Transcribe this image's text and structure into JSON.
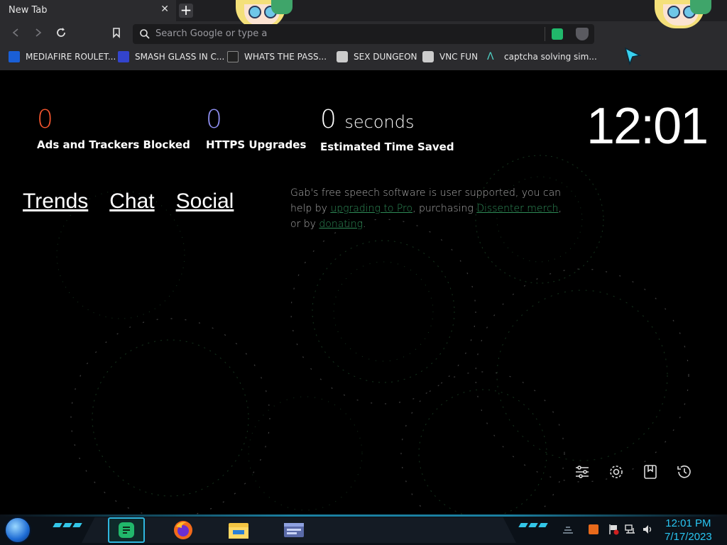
{
  "browser": {
    "tab_title": "New Tab",
    "tab_close": "✕",
    "new_tab": "+",
    "omnibox_placeholder": "Search Google or type a",
    "bookmarks": [
      {
        "label": "MEDIAFIRE ROULET...",
        "icon": "mediafire-icon",
        "color": "#1a5fd6"
      },
      {
        "label": "SMASH GLASS IN C...",
        "icon": "smash-glass-icon",
        "color": "#3344cc"
      },
      {
        "label": "WHATS THE PASS...",
        "icon": "lock-icon",
        "color": "#222222"
      },
      {
        "label": "SEX DUNGEON",
        "icon": "cube-icon",
        "color": "#dddddd"
      },
      {
        "label": "VNC FUN",
        "icon": "cube-icon",
        "color": "#dddddd"
      },
      {
        "label": "captcha solving sim...",
        "icon": "captcha-icon",
        "color": "#4fd1c5"
      }
    ]
  },
  "stats": {
    "ads": {
      "value": "0",
      "label": "Ads and Trackers Blocked",
      "color": "#f4552e"
    },
    "https": {
      "value": "0",
      "label": "HTTPS Upgrades",
      "color": "#8f8ff2"
    },
    "time": {
      "value": "0",
      "unit": "seconds",
      "label": "Estimated Time Saved",
      "color": "#ffffff"
    }
  },
  "clock": "12:01",
  "links": [
    "Trends",
    "Chat",
    "Social"
  ],
  "gab": {
    "t1": "Gab's free speech software is user supported, you can help by ",
    "l1": "upgrading to Pro",
    "t2": ", purchasing ",
    "l2": "Dissenter merch",
    "t3": ", or by ",
    "l3": "donating",
    "t4": "."
  },
  "bottom_icons": [
    "customize-icon",
    "gear-icon",
    "bookmarks-icon",
    "history-icon"
  ],
  "taskbar": {
    "time": "12:01 PM",
    "date": "7/17/2023",
    "apps": [
      "gab-icon",
      "firefox-icon",
      "file-explorer-icon",
      "window-icon"
    ]
  },
  "colors": {
    "link": "#2e8b57",
    "accent_cyan": "#29c6f2"
  }
}
